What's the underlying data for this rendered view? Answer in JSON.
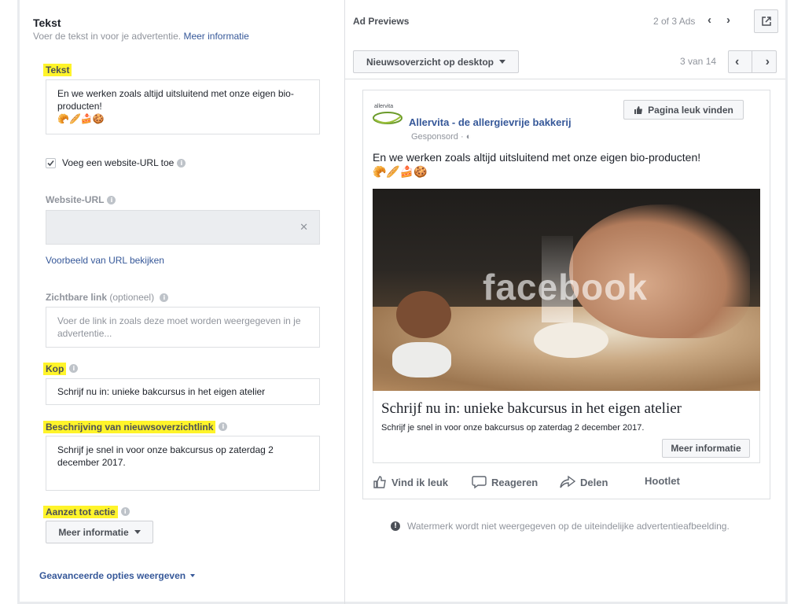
{
  "left": {
    "title": "Tekst",
    "subtitle": "Voer de tekst in voor je advertentie.",
    "more_info": "Meer informatie",
    "text_label": "Tekst",
    "text_value": "En we werken zoals altijd uitsluitend met onze eigen bio-producten!",
    "text_emojis": "🥐🥖🍰🍪",
    "checkbox_label": "Voeg een website-URL toe",
    "website_label": "Website-URL",
    "url_preview_link": "Voorbeeld van URL bekijken",
    "display_link_label": "Zichtbare link",
    "display_link_optional": "(optioneel)",
    "display_link_placeholder": "Voer de link in zoals deze moet worden weergegeven in je advertentie...",
    "headline_label": "Kop",
    "headline_value": "Schrijf nu in: unieke bakcursus in het eigen atelier",
    "desc_label": "Beschrijving van nieuwsoverzichtlink",
    "desc_value": "Schrijf je snel in voor onze bakcursus op zaterdag 2 december 2017.",
    "cta_label": "Aanzet tot actie",
    "cta_value": "Meer informatie",
    "advanced": "Geavanceerde opties weergeven"
  },
  "right": {
    "title": "Ad Previews",
    "ad_counter": "2 of 3 Ads",
    "placement": "Nieuwsoverzicht op desktop",
    "page_counter": "3 van 14",
    "advertiser": "Allervita - de allergievrije bakkerij",
    "logo_text": "allervita",
    "sponsored": "Gesponsord",
    "like_page": "Pagina leuk vinden",
    "post_text": "En we werken zoals altijd uitsluitend met onze eigen bio-producten!",
    "post_emojis": "🥐🥖🍰🍪",
    "watermark": "facebook",
    "headline": "Schrijf nu in: unieke bakcursus in het eigen atelier",
    "description": "Schrijf je snel in voor onze bakcursus op zaterdag 2 december 2017.",
    "cta": "Meer informatie",
    "actions": {
      "like": "Vind ik leuk",
      "comment": "Reageren",
      "share": "Delen",
      "hootlet": "Hootlet"
    },
    "footer_note": "Watermerk wordt niet weergegeven op de uiteindelijke advertentieafbeelding."
  },
  "colors": {
    "highlight": "#fff42a",
    "link": "#365899",
    "advertiser": "#365899"
  }
}
